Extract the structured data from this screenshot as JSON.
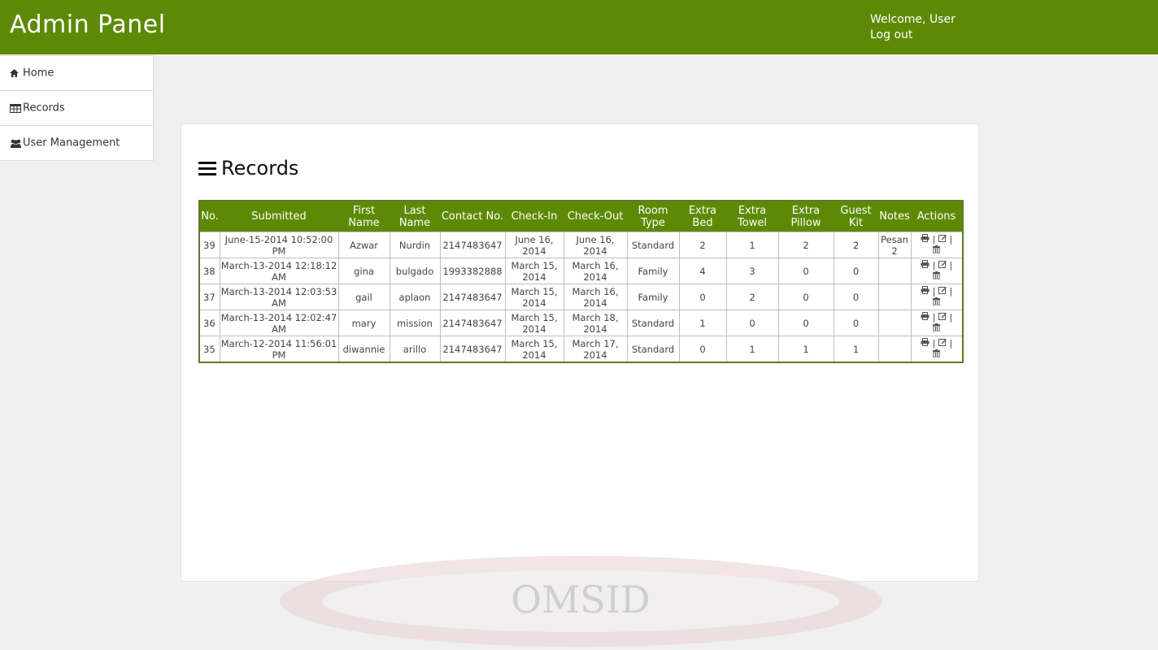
{
  "header": {
    "brand": "Admin Panel",
    "welcome": "Welcome, User",
    "logout": "Log out"
  },
  "sidebar": {
    "items": [
      {
        "label": "Home",
        "icon": "home-icon"
      },
      {
        "label": "Records",
        "icon": "table-icon"
      },
      {
        "label": "User Management",
        "icon": "users-icon"
      }
    ]
  },
  "main": {
    "title": "Records",
    "table": {
      "columns": [
        "No.",
        "Submitted",
        "First Name",
        "Last Name",
        "Contact No.",
        "Check-In",
        "Check-Out",
        "Room Type",
        "Extra Bed",
        "Extra Towel",
        "Extra Pillow",
        "Guest Kit",
        "Notes",
        "Actions"
      ],
      "rows": [
        {
          "no": "39",
          "submitted": "June-15-2014 10:52:00 PM",
          "first": "Azwar",
          "last": "Nurdin",
          "contact": "2147483647",
          "checkin": "June 16, 2014",
          "checkout": "June 16, 2014",
          "room": "Standard",
          "bed": "2",
          "towel": "1",
          "pillow": "2",
          "kit": "2",
          "notes": "Pesan 2"
        },
        {
          "no": "38",
          "submitted": "March-13-2014 12:18:12 AM",
          "first": "gina",
          "last": "bulgado",
          "contact": "1993382888",
          "checkin": "March 15, 2014",
          "checkout": "March 16, 2014",
          "room": "Family",
          "bed": "4",
          "towel": "3",
          "pillow": "0",
          "kit": "0",
          "notes": ""
        },
        {
          "no": "37",
          "submitted": "March-13-2014 12:03:53 AM",
          "first": "gail",
          "last": "aplaon",
          "contact": "2147483647",
          "checkin": "March 15, 2014",
          "checkout": "March 16, 2014",
          "room": "Family",
          "bed": "0",
          "towel": "2",
          "pillow": "0",
          "kit": "0",
          "notes": ""
        },
        {
          "no": "36",
          "submitted": "March-13-2014 12:02:47 AM",
          "first": "mary",
          "last": "mission",
          "contact": "2147483647",
          "checkin": "March 15, 2014",
          "checkout": "March 18, 2014",
          "room": "Standard",
          "bed": "1",
          "towel": "0",
          "pillow": "0",
          "kit": "0",
          "notes": ""
        },
        {
          "no": "35",
          "submitted": "March-12-2014 11:56:01 PM",
          "first": "diwannie",
          "last": "arillo",
          "contact": "2147483647",
          "checkin": "March 15, 2014",
          "checkout": "March 17, 2014",
          "room": "Standard",
          "bed": "0",
          "towel": "1",
          "pillow": "1",
          "kit": "1",
          "notes": ""
        }
      ]
    },
    "actions": {
      "separator": "|",
      "print_icon": "print-icon",
      "edit_icon": "edit-icon",
      "delete_icon": "trash-icon"
    }
  },
  "watermark": {
    "text": "OMSID"
  },
  "colors": {
    "accent": "#5d8a05",
    "background": "#f0f0f0"
  }
}
